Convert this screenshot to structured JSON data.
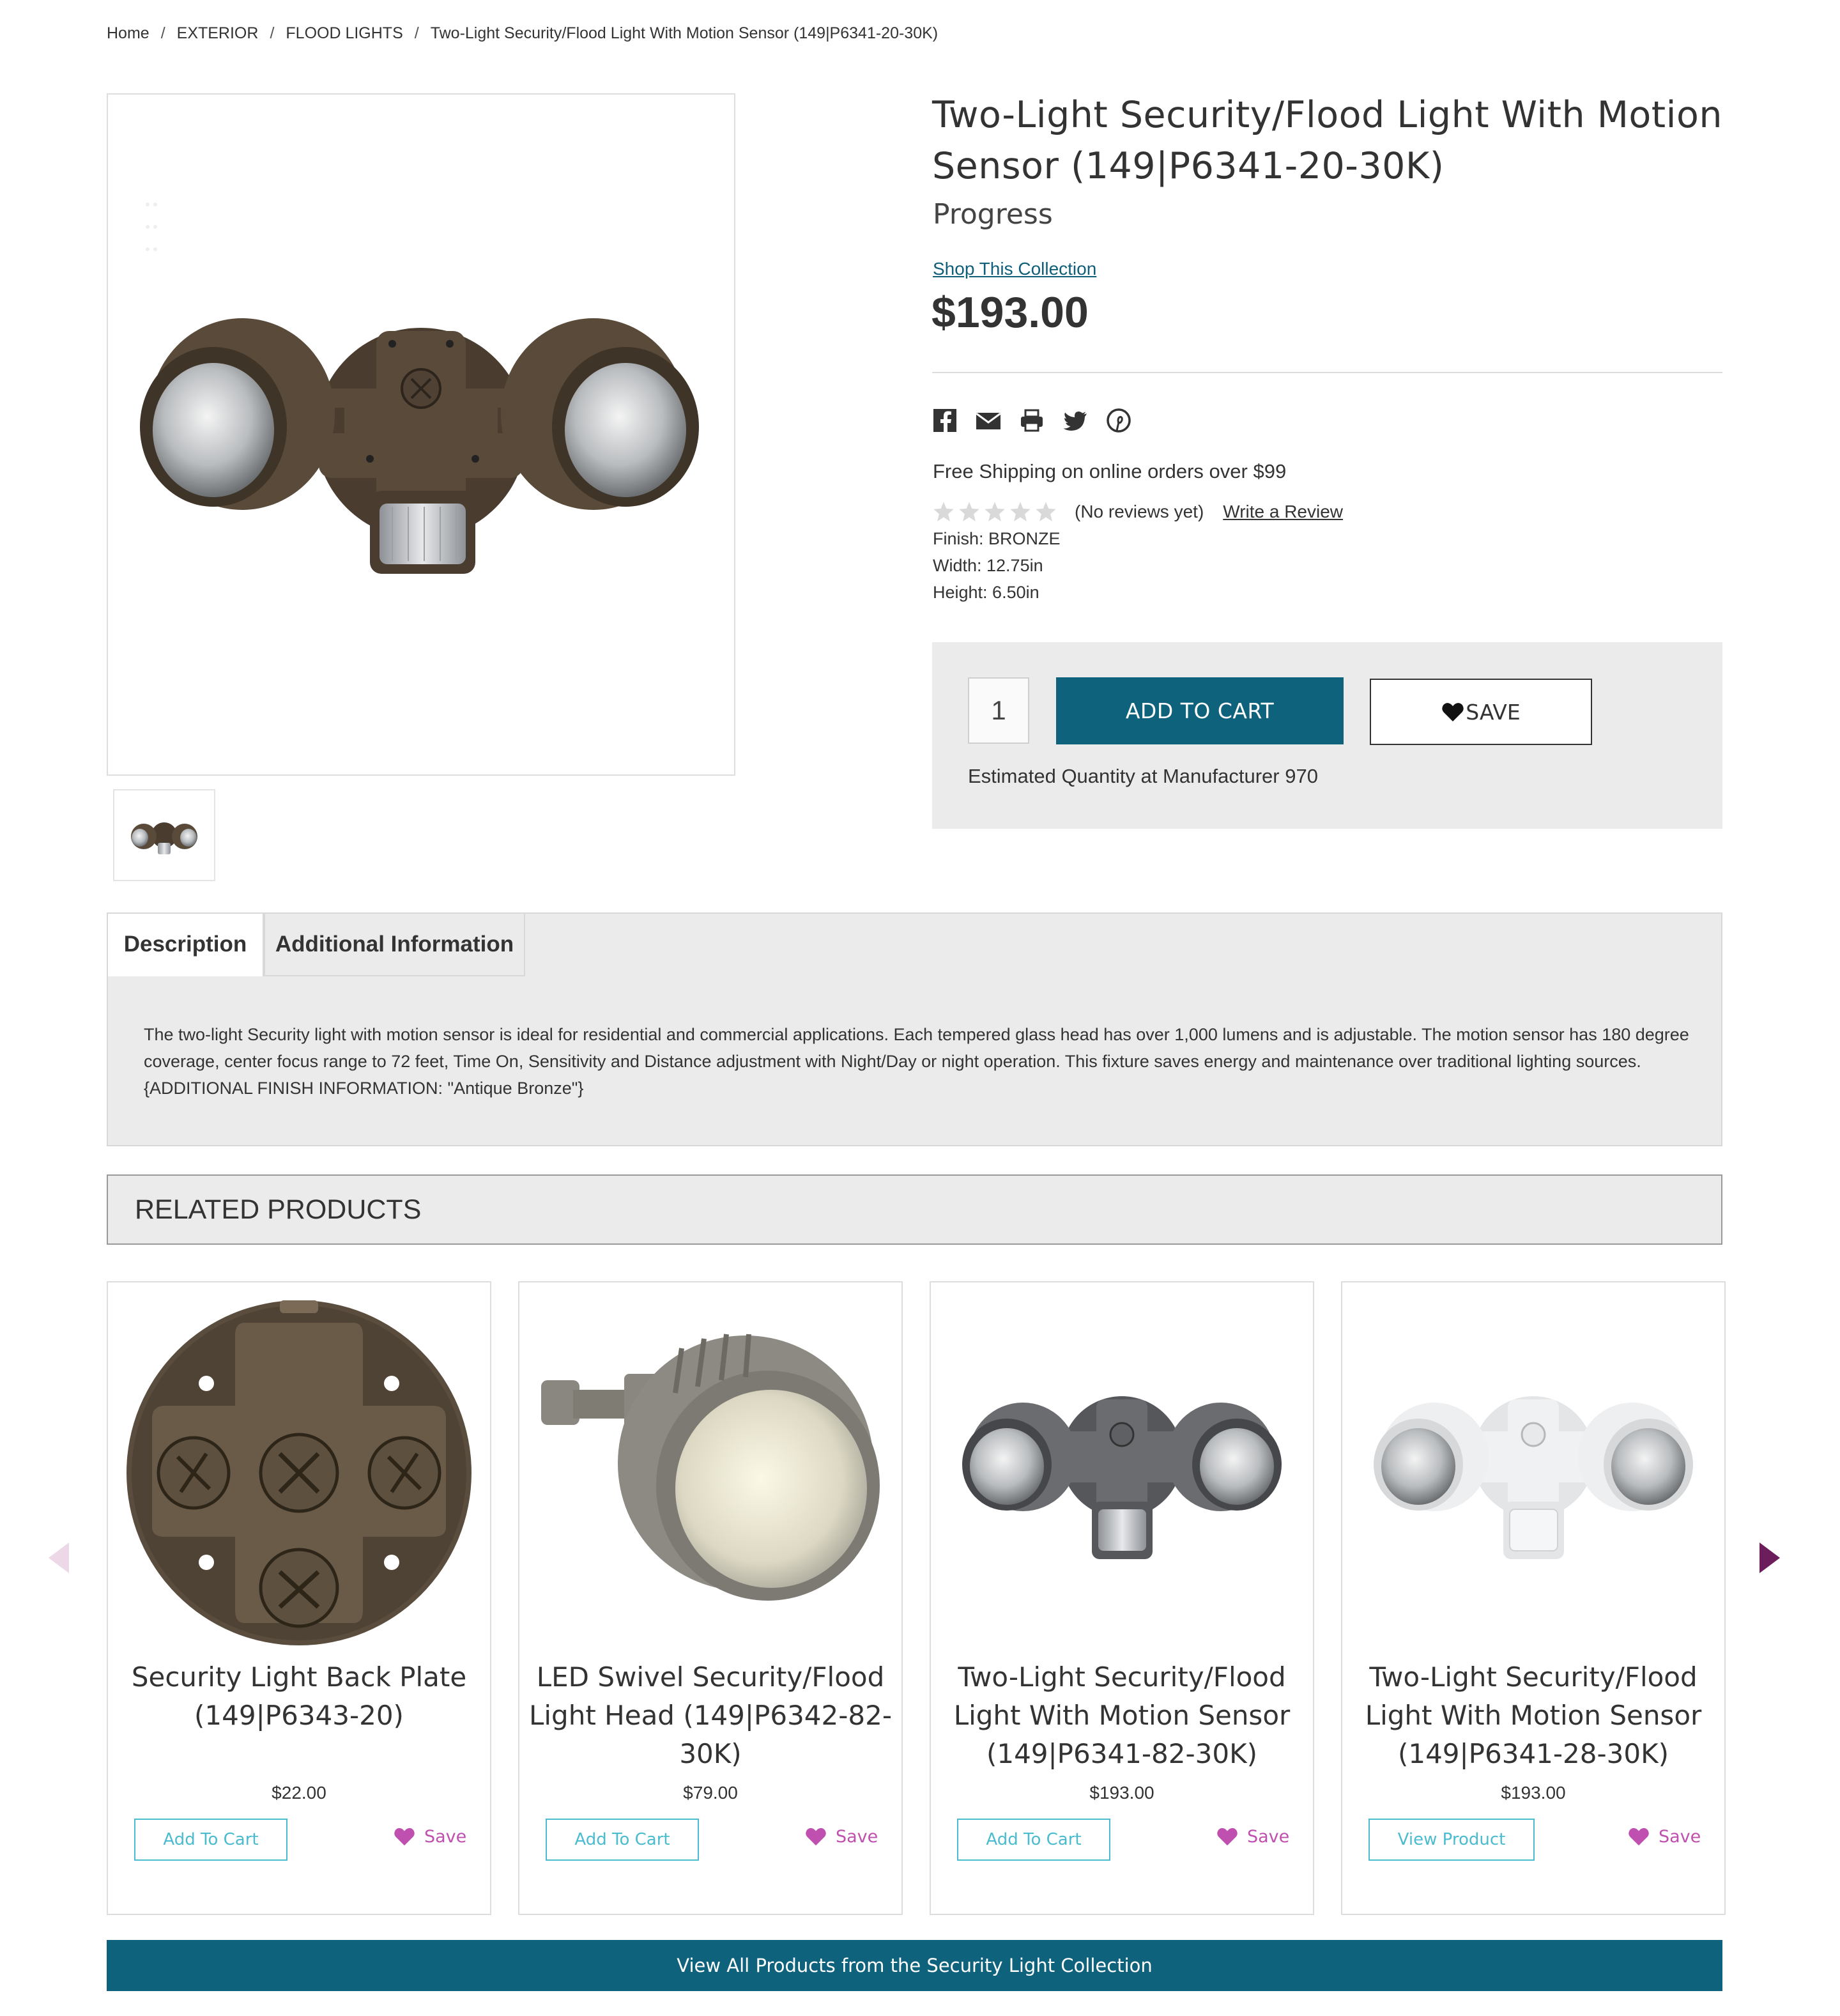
{
  "breadcrumb": {
    "items": [
      "Home",
      "EXTERIOR",
      "FLOOD LIGHTS",
      "Two-Light Security/Flood Light With Motion Sensor (149|P6341-20-30K)"
    ],
    "separator": "/"
  },
  "product": {
    "title": "Two-Light Security/Flood Light With Motion Sensor (149|P6341-20-30K)",
    "brand": "Progress",
    "collection_link": "Shop This Collection",
    "price": "$193.00",
    "shipping": "Free Shipping on online orders over $99",
    "rating": 0,
    "reviews_text": "(No reviews yet)",
    "write_review": "Write a Review",
    "finish": "Finish: BRONZE",
    "width": "Width: 12.75in",
    "height": "Height: 6.50in"
  },
  "social": [
    "facebook-icon",
    "email-icon",
    "print-icon",
    "twitter-icon",
    "pinterest-icon"
  ],
  "cart": {
    "quantity": "1",
    "add_to_cart": "ADD TO CART",
    "save": "SAVE",
    "estimated": "Estimated Quantity at Manufacturer 970"
  },
  "tabs": {
    "description_label": "Description",
    "additional_label": "Additional Information",
    "description_text": "The two-light Security light with motion sensor is ideal for residential and commercial applications. Each tempered glass head has over 1,000 lumens and is adjustable. The motion sensor has 180 degree coverage, center focus range to 72 feet, Time On, Sensitivity and Distance adjustment with Night/Day or night operation. This fixture saves energy and maintenance over traditional lighting sources. {ADDITIONAL FINISH INFORMATION: \"Antique Bronze\"}"
  },
  "related": {
    "heading": "RELATED PRODUCTS",
    "products": [
      {
        "name": "Security Light Back Plate (149|P6343-20)",
        "price": "$22.00",
        "button": "Add To Cart",
        "save": "Save"
      },
      {
        "name": "LED Swivel Security/Flood Light Head (149|P6342-82-30K)",
        "price": "$79.00",
        "button": "Add To Cart",
        "save": "Save"
      },
      {
        "name": "Two-Light Security/Flood Light With Motion Sensor (149|P6341-82-30K)",
        "price": "$193.00",
        "button": "Add To Cart",
        "save": "Save"
      },
      {
        "name": "Two-Light Security/Flood Light With Motion Sensor (149|P6341-28-30K)",
        "price": "$193.00",
        "button": "View Product",
        "save": "Save"
      }
    ],
    "view_all": "View All Products from the Security Light Collection"
  },
  "colors": {
    "teal": "#0f627c",
    "link": "#0f5e7a",
    "outline_button": "#4bbcd0",
    "save_heart": "#c050b0",
    "arrow_active": "#6b1d5c",
    "arrow_inactive": "#ecd8e6",
    "bronze": "#4a3d30"
  }
}
